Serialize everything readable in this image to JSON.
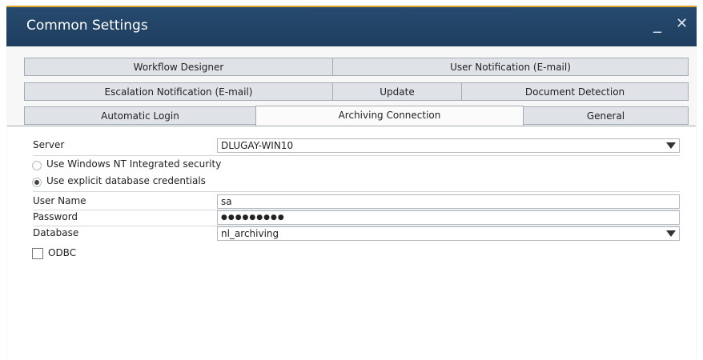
{
  "window": {
    "title": "Common Settings",
    "minimize_glyph": "_",
    "close_glyph": "✕"
  },
  "tabs": {
    "row1": [
      "Workflow Designer",
      "User Notification (E-mail)"
    ],
    "row2": [
      "Escalation Notification (E-mail)",
      "Update",
      "Document Detection"
    ],
    "row3": [
      "Automatic Login",
      "Archiving Connection",
      "General"
    ],
    "active": "Archiving Connection"
  },
  "form": {
    "server_label": "Server",
    "server_value": "DLUGAY-WIN10",
    "auth_options": [
      {
        "label": "Use Windows NT Integrated security",
        "checked": false
      },
      {
        "label": "Use explicit database credentials",
        "checked": true
      }
    ],
    "username_label": "User Name",
    "username_value": "sa",
    "password_label": "Password",
    "password_value": "●●●●●●●●●",
    "database_label": "Database",
    "database_value": "nl_archiving",
    "odbc_label": "ODBC",
    "odbc_checked": false
  }
}
